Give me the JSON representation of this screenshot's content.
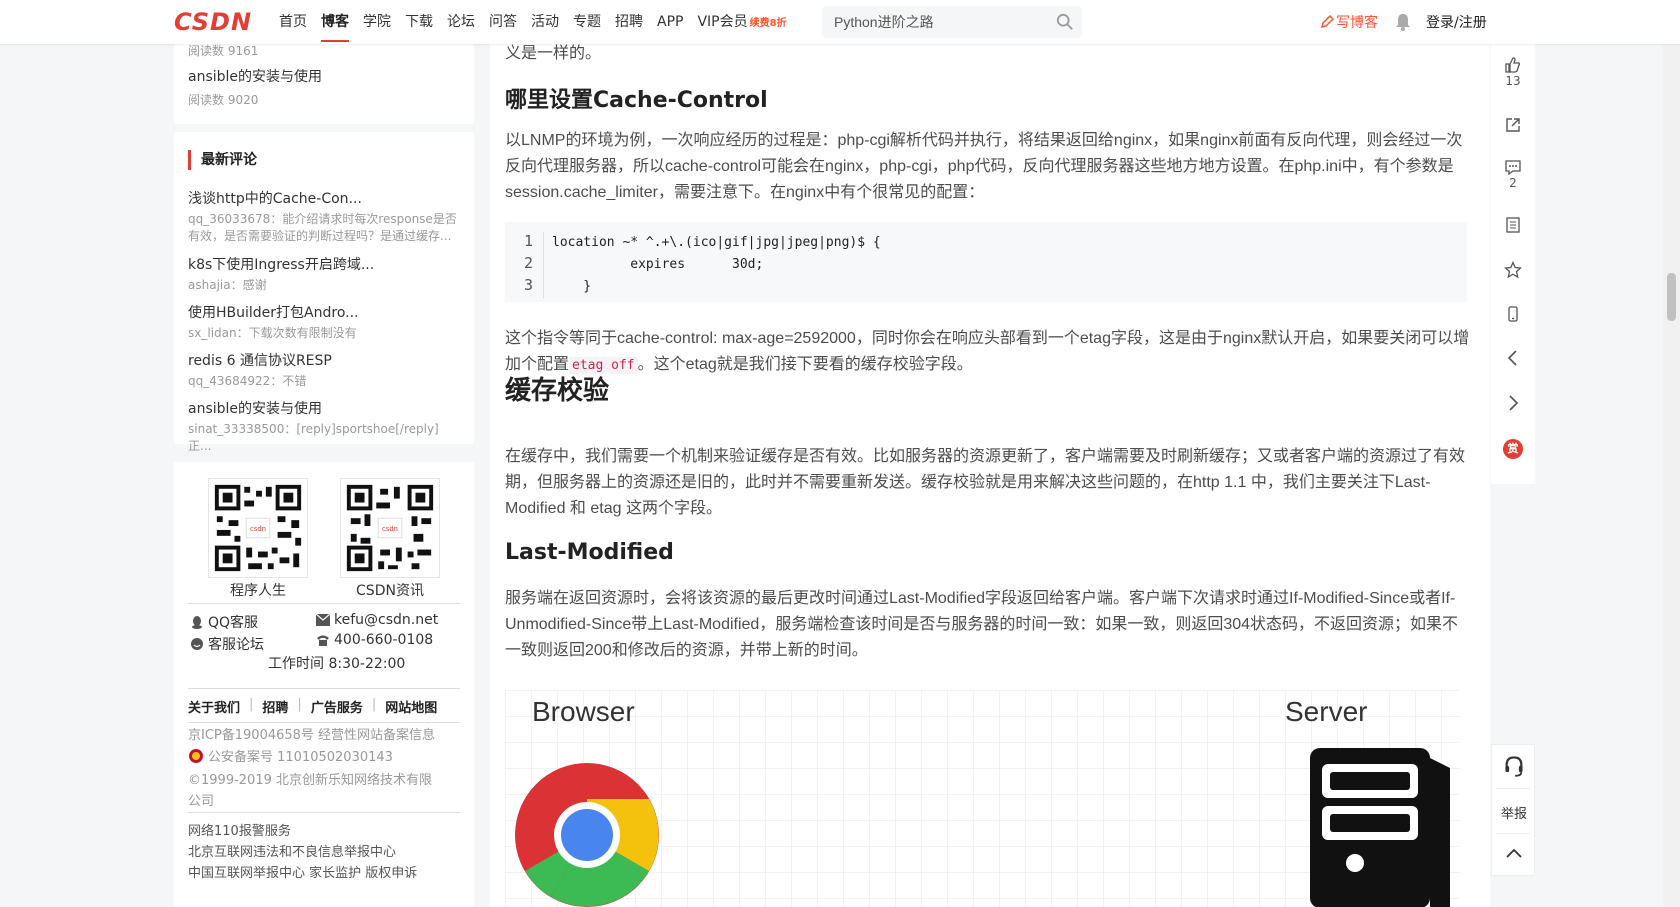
{
  "nav": {
    "logo": "CSDN",
    "links": [
      "首页",
      "博客",
      "学院",
      "下载",
      "论坛",
      "问答",
      "活动",
      "专题",
      "招聘",
      "APP",
      "VIP会员"
    ],
    "vip_badge": "续费8折",
    "search_value": "Python进阶之路",
    "write_blog": "写博客",
    "login": "登录/注册"
  },
  "sidebar": {
    "top_items": [
      {
        "meta": "阅读数 9161"
      },
      {
        "title": "ansible的安装与使用",
        "meta": "阅读数 9020"
      }
    ],
    "comments_title": "最新评论",
    "comments": [
      {
        "title": "浅谈http中的Cache-Con...",
        "text": "qq_36033678：能介绍请求时每次response是否有效，是否需要验证的判断过程吗？是通过缓存..."
      },
      {
        "title": "k8s下使用Ingress开启跨域...",
        "text": "ashajia：感谢"
      },
      {
        "title": "使用HBuilder打包Andro...",
        "text": "sx_lidan：下载次数有限制没有"
      },
      {
        "title": "redis 6 通信协议RESP",
        "text": "qq_43684922：不错"
      },
      {
        "title": "ansible的安装与使用",
        "text": "sinat_33338500：[reply]sportshoe[/reply] 正..."
      }
    ],
    "qr": [
      {
        "label": "程序人生"
      },
      {
        "label": "CSDN资讯"
      }
    ],
    "contact": {
      "qq": "QQ客服",
      "email": "kefu@csdn.net",
      "forum": "客服论坛",
      "phone": "400-660-0108",
      "hours": "工作时间 8:30-22:00"
    },
    "footer_links": [
      "关于我们",
      "招聘",
      "广告服务",
      "网站地图"
    ],
    "icp": "京ICP备19004658号  经营性网站备案信息",
    "police": "公安备案号 11010502030143",
    "copyright_1": "©1999-2019 北京创新乐知网络技术有限",
    "copyright_2": "公司",
    "report_1": "网络110报警服务",
    "report_2": "北京互联网违法和不良信息举报中心",
    "report_3": "中国互联网举报中心  家长监护  版权申诉"
  },
  "article": {
    "top_text": "义是一样的。",
    "h_where": "哪里设置Cache-Control",
    "p_where": "以LNMP的环境为例，一次响应经历的过程是：php-cgi解析代码并执行，将结果返回给nginx，如果nginx前面有反向代理，则会经过一次反向代理服务器，所以cache-control可能会在nginx，php-cgi，php代码，反向代理服务器这些地方地方设置。在php.ini中，有个参数是session.cache_limiter，需要注意下。在nginx中有个很常见的配置：",
    "code": [
      {
        "n": "1",
        "text": "location ~* ^.+\\.(ico|gif|jpg|jpeg|png)$ {"
      },
      {
        "n": "2",
        "text": "          expires      30d;"
      },
      {
        "n": "3",
        "text": "    }"
      }
    ],
    "p_etag_1": "这个指令等同于cache-control: max-age=2592000，同时你会在响应头部看到一个etag字段，这是由于nginx默认开启，如果要关闭可以增加个配置",
    "etag_code": "etag off",
    "p_etag_2": "。这个etag就是我们接下要看的缓存校验字段。",
    "h_validate": "缓存校验",
    "p_validate": "在缓存中，我们需要一个机制来验证缓存是否有效。比如服务器的资源更新了，客户端需要及时刷新缓存；又或者客户端的资源过了有效期，但服务器上的资源还是旧的，此时并不需要重新发送。缓存校验就是用来解决这些问题的，在http 1.1 中，我们主要关注下Last-Modified 和 etag 这两个字段。",
    "h_lastmod": "Last-Modified",
    "p_lastmod": "服务端在返回资源时，会将该资源的最后更改时间通过Last-Modified字段返回给客户端。客户端下次请求时通过If-Modified-Since或者If-Unmodified-Since带上Last-Modified，服务端检查该时间是否与服务器的时间一致：如果一致，则返回304状态码，不返回资源；如果不一致则返回200和修改后的资源，并带上新的时间。",
    "diagram_browser": "Browser",
    "diagram_server": "Server"
  },
  "toolbar": {
    "like_count": "13",
    "comment_count": "2",
    "reward": "赏",
    "report": "举报"
  }
}
